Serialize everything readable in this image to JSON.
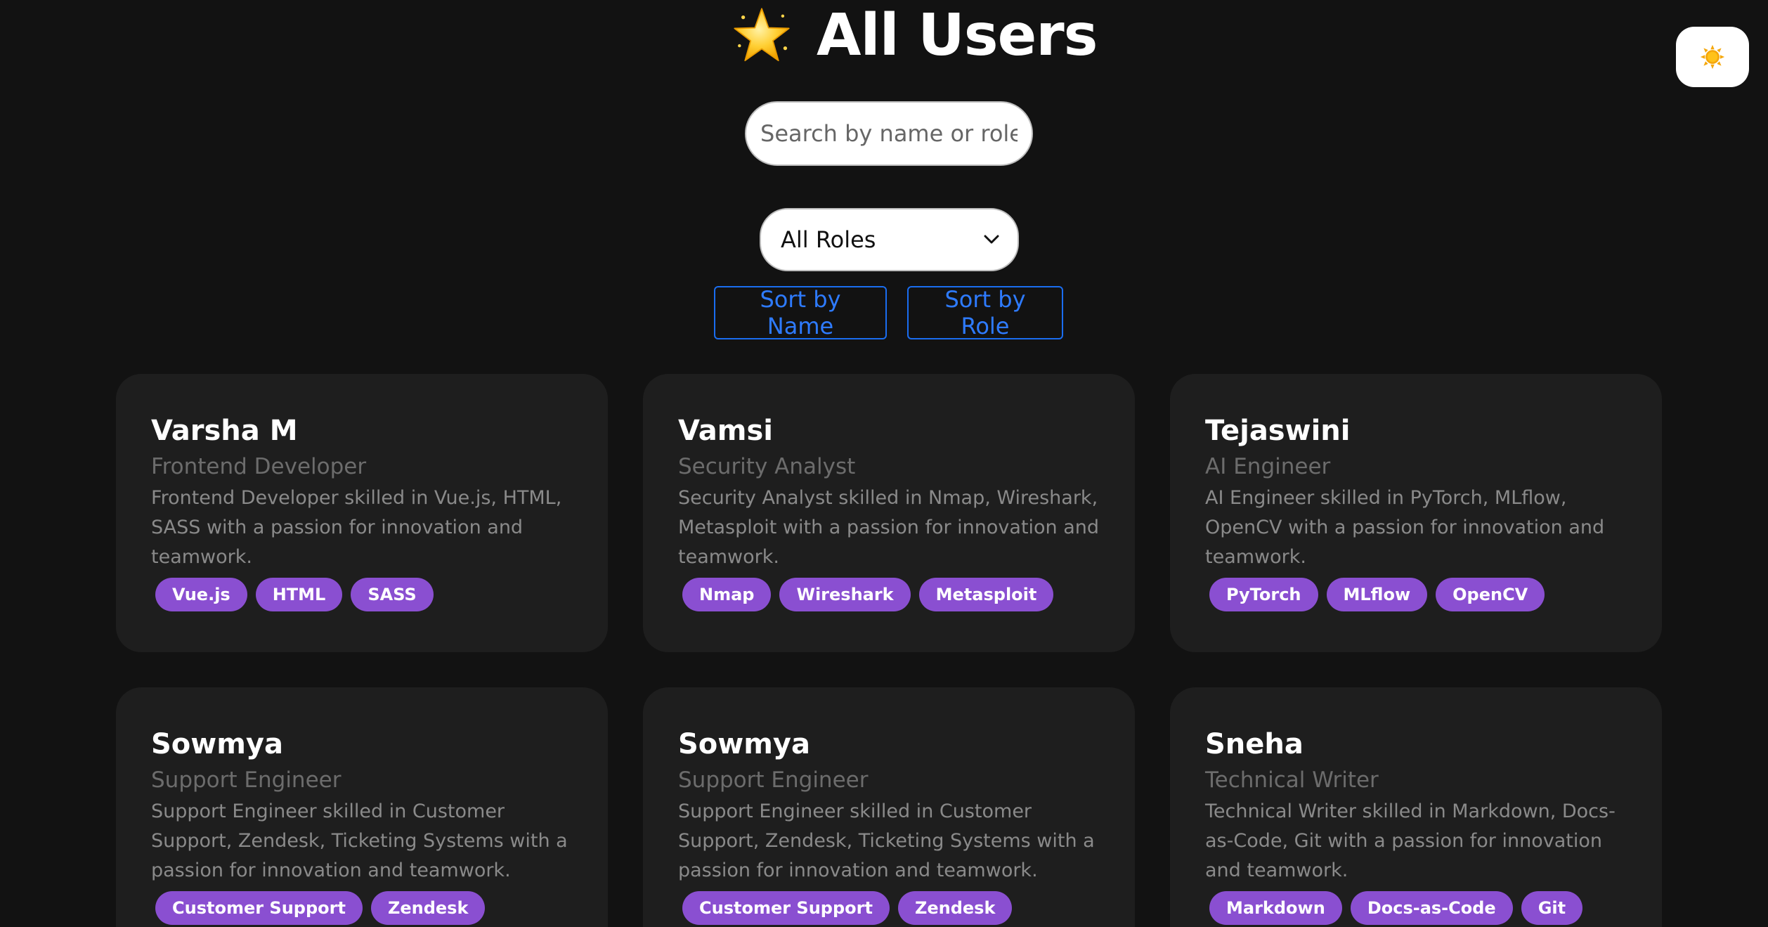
{
  "header": {
    "title": "All Users",
    "title_icon": "star-icon",
    "theme_toggle_icon": "sun-icon"
  },
  "search": {
    "placeholder": "Search by name or role...",
    "value": ""
  },
  "filter": {
    "selected": "All Roles"
  },
  "sort": {
    "by_name_label": "Sort by Name",
    "by_role_label": "Sort by Role"
  },
  "colors": {
    "background": "#121212",
    "card": "#1e1e1e",
    "tag": "#8a4fd1",
    "accent_blue": "#2e7bff"
  },
  "users": [
    {
      "name": "Varsha M",
      "role": "Frontend Developer",
      "description": "Frontend Developer skilled in Vue.js, HTML, SASS with a passion for innovation and teamwork.",
      "skills": [
        "Vue.js",
        "HTML",
        "SASS"
      ]
    },
    {
      "name": "Vamsi",
      "role": "Security Analyst",
      "description": "Security Analyst skilled in Nmap, Wireshark, Metasploit with a passion for innovation and teamwork.",
      "skills": [
        "Nmap",
        "Wireshark",
        "Metasploit"
      ]
    },
    {
      "name": "Tejaswini",
      "role": "AI Engineer",
      "description": "AI Engineer skilled in PyTorch, MLflow, OpenCV with a passion for innovation and teamwork.",
      "skills": [
        "PyTorch",
        "MLflow",
        "OpenCV"
      ]
    },
    {
      "name": "Sowmya",
      "role": "Support Engineer",
      "description": "Support Engineer skilled in Customer Support, Zendesk, Ticketing Systems with a passion for innovation and teamwork.",
      "skills": [
        "Customer Support",
        "Zendesk"
      ]
    },
    {
      "name": "Sowmya",
      "role": "Support Engineer",
      "description": "Support Engineer skilled in Customer Support, Zendesk, Ticketing Systems with a passion for innovation and teamwork.",
      "skills": [
        "Customer Support",
        "Zendesk"
      ]
    },
    {
      "name": "Sneha",
      "role": "Technical Writer",
      "description": "Technical Writer skilled in Markdown, Docs-as-Code, Git with a passion for innovation and teamwork.",
      "skills": [
        "Markdown",
        "Docs-as-Code",
        "Git"
      ]
    }
  ]
}
